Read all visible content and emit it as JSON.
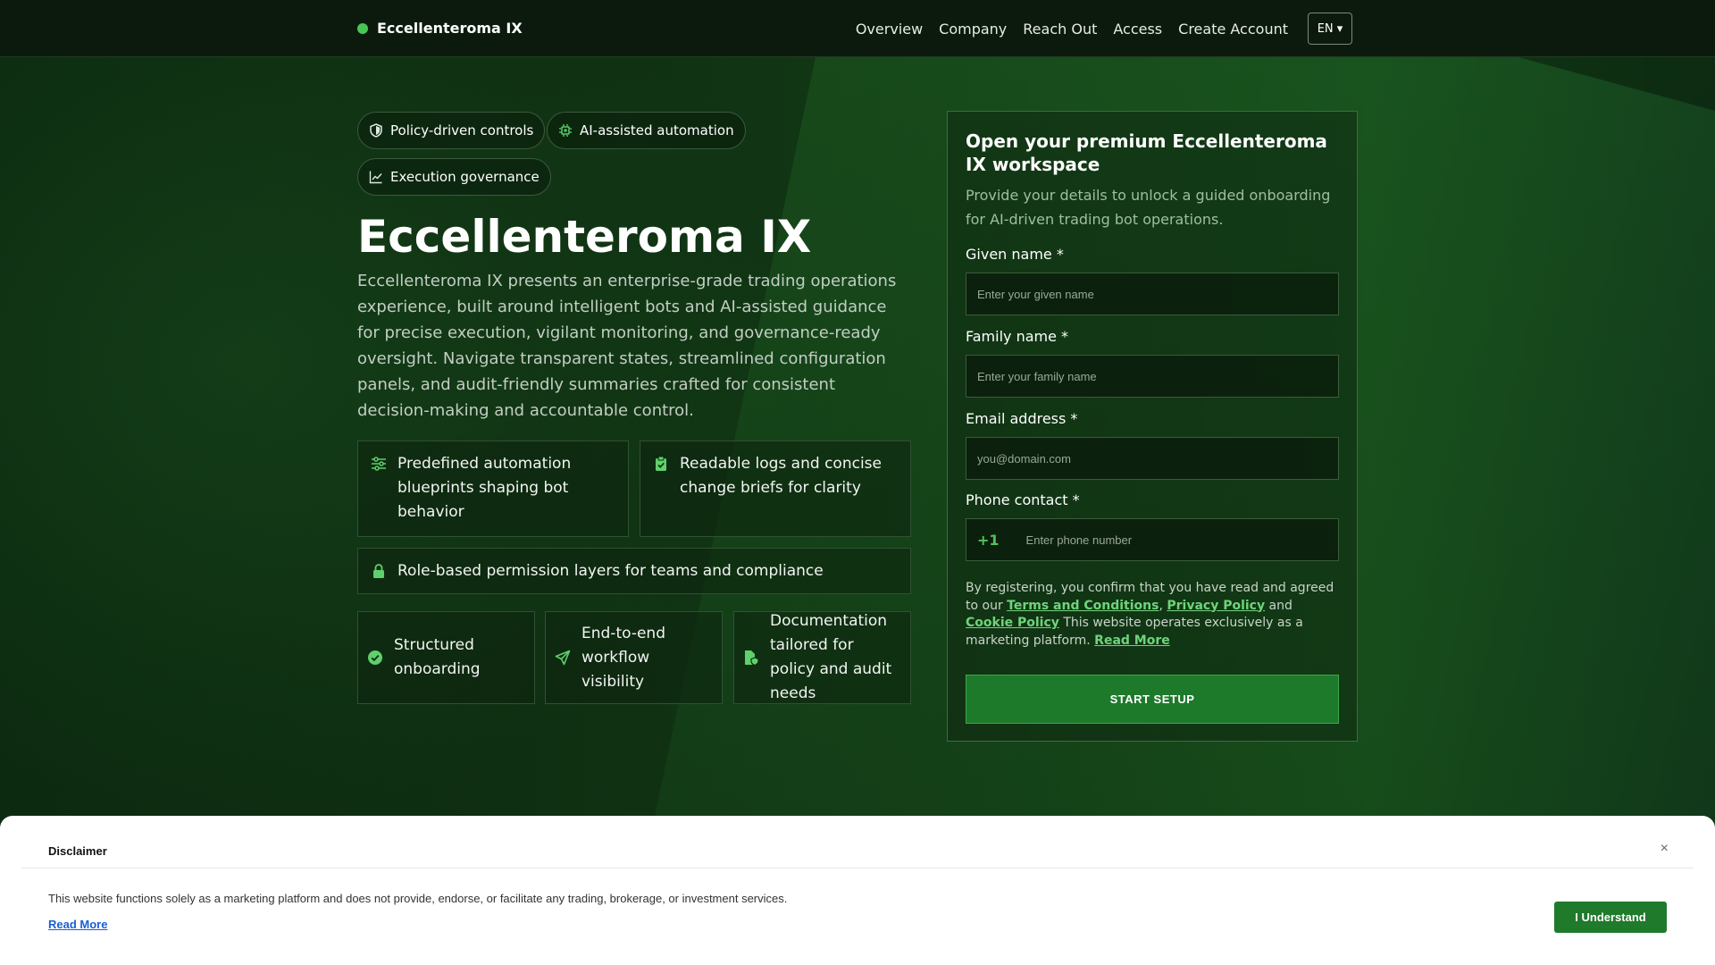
{
  "nav": {
    "brand": "Eccellenteroma IX",
    "links": [
      "Overview",
      "Company",
      "Reach Out",
      "Access",
      "Create Account"
    ],
    "lang": "EN ▾"
  },
  "hero": {
    "chips": [
      "Policy-driven controls",
      "AI-assisted automation",
      "Execution governance"
    ],
    "title": "Eccellenteroma IX",
    "description": "Eccellenteroma IX presents an enterprise-grade trading operations experience, built around intelligent bots and AI-assisted guidance for precise execution, vigilant monitoring, and governance-ready oversight. Navigate transparent states, streamlined configuration panels, and audit-friendly summaries crafted for consistent decision-making and accountable control.",
    "features": [
      "Predefined automation blueprints shaping bot behavior",
      "Readable logs and concise change briefs for clarity",
      "Role-based permission layers for teams and compliance"
    ],
    "mini_features": [
      "Structured onboarding",
      "End-to-end workflow visibility",
      "Documentation tailored for policy and audit needs"
    ]
  },
  "form": {
    "title": "Open your premium Eccellenteroma IX workspace",
    "subtitle": "Provide your details to unlock a guided onboarding for AI-driven trading bot operations.",
    "given_label": "Given name *",
    "given_placeholder": "Enter your given name",
    "family_label": "Family name *",
    "family_placeholder": "Enter your family name",
    "email_label": "Email address *",
    "email_placeholder": "you@domain.com",
    "phone_label": "Phone contact *",
    "phone_prefix": "+1",
    "phone_placeholder": "Enter phone number",
    "consent_1": "By registering, you confirm that you have read and agreed to our ",
    "terms": "Terms and Conditions",
    "sep": ", ",
    "privacy": "Privacy Policy",
    "and": " and ",
    "cookie": "Cookie Policy",
    "consent_2": " This website operates exclusively as a marketing platform. ",
    "read_more": "Read More",
    "submit": "START SETUP"
  },
  "disclaimer": {
    "title": "Disclaimer",
    "close": "×",
    "text": "This website functions solely as a marketing platform and does not provide, endorse, or facilitate any trading, brokerage, or investment services.",
    "read_more": "Read More",
    "button": "I Understand"
  },
  "colors": {
    "accent": "#46c755",
    "button": "#1f7a2b"
  }
}
